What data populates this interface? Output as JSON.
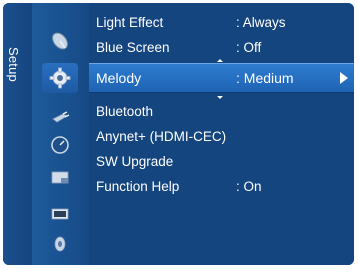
{
  "sidebar": {
    "category_label": "Setup",
    "icons": [
      "satellite-dish-icon",
      "gear-setup-icon",
      "input-plug-icon",
      "support-dial-icon",
      "media-folder-icon",
      "picture-screen-icon",
      "sound-speaker-icon"
    ]
  },
  "menu": {
    "items": [
      {
        "label": "Light Effect",
        "value": ": Always"
      },
      {
        "label": "Blue Screen",
        "value": ": Off"
      },
      {
        "label": "Melody",
        "value": ": Medium",
        "selected": true
      },
      {
        "label": "Bluetooth",
        "value": ""
      },
      {
        "label": "Anynet+ (HDMI-CEC)",
        "value": ""
      },
      {
        "label": "SW Upgrade",
        "value": ""
      },
      {
        "label": "Function Help",
        "value": ": On"
      }
    ]
  },
  "colors": {
    "panel_bg": "#15457f",
    "icon_column_bg": "#1e5a9b",
    "selected_row": "#2f7cd0",
    "text": "#ffffff"
  }
}
